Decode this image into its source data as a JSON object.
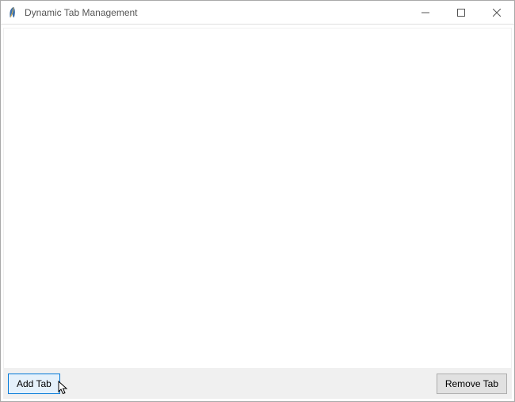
{
  "window": {
    "title": "Dynamic Tab Management"
  },
  "buttons": {
    "add_label": "Add Tab",
    "remove_label": "Remove Tab"
  },
  "icons": {
    "app": "feather-icon",
    "minimize": "minimize-icon",
    "maximize": "maximize-icon",
    "close": "close-icon"
  }
}
